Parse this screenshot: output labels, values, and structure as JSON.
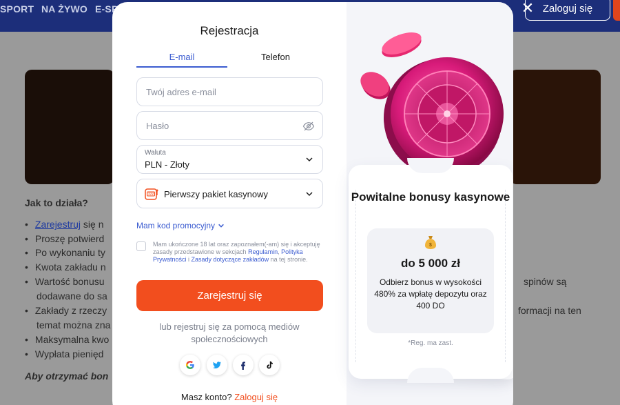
{
  "background": {
    "nav": [
      "SPORT",
      "NA ŻYWO",
      "E-SP"
    ],
    "login_button": "Zaloguj się",
    "how_it_works": "Jak to działa?",
    "list_items": [
      {
        "link": "Zarejestruj",
        "text": " się n"
      },
      {
        "text": "Proszę potwierd"
      },
      {
        "text": "Po wykonaniu ty"
      },
      {
        "text": "Kwota zakładu n"
      },
      {
        "text": "Wartość bonusu"
      },
      {
        "text": "dodawane do sa"
      },
      {
        "text": "Zakłady z rzeczy"
      },
      {
        "text": "temat można zna"
      },
      {
        "text": "Maksymalna kwo"
      },
      {
        "text": "Wypłata pienięd"
      }
    ],
    "footer_italic": "Aby otrzymać bon",
    "right_texts": [
      "spinów są",
      "formacji na ten"
    ]
  },
  "modal": {
    "close": "✕",
    "title": "Rejestracja",
    "tabs": {
      "email": "E-mail",
      "phone": "Telefon"
    },
    "email_placeholder": "Twój adres e-mail",
    "password_placeholder": "Hasło",
    "currency": {
      "label": "Waluta",
      "value": "PLN - Złoty"
    },
    "package": {
      "value": "Pierwszy pakiet kasynowy"
    },
    "promo_link": "Mam kod promocyjny",
    "consent": {
      "text_1": "Mam ukończone 18 lat oraz zapoznałem(-am) się i akceptuję zasady przedstawione w sekcjach ",
      "link_1": "Regulamin",
      "sep_1": ", ",
      "link_2": "Polityka Prywatności",
      "sep_2": " i ",
      "link_3": "Zasady dotyczące zakładów",
      "text_2": " na tej stronie."
    },
    "register_button": "Zarejestruj się",
    "social_text": "lub rejestruj się za pomocą mediów społecznościowych",
    "social": [
      "G",
      "t",
      "f",
      "♪"
    ],
    "have_account": "Masz konto?",
    "login_link": "Zaloguj się"
  },
  "bonus": {
    "title": "Powitalne bonusy kasynowe",
    "amount": "do 5 000 zł",
    "description": "Odbierz bonus w wysokości 480% za wpłatę depozytu oraz 400 DO",
    "note": "*Reg. ma zast."
  },
  "colors": {
    "accent": "#f24e1e",
    "link": "#3a5bd0",
    "nav_bg": "#1c2e7a",
    "roulette": "#d81b7a"
  }
}
